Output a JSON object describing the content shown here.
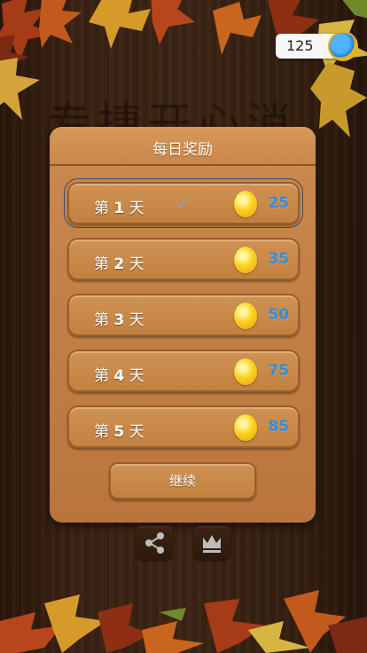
{
  "coins": {
    "value": "125"
  },
  "background_title": "专捷开心消",
  "dialog": {
    "title": "每日奖励",
    "rows": [
      {
        "prefix": "第",
        "num": "1",
        "suffix": "天",
        "amount": "25",
        "claimed": true
      },
      {
        "prefix": "第",
        "num": "2",
        "suffix": "天",
        "amount": "35",
        "claimed": false
      },
      {
        "prefix": "第",
        "num": "3",
        "suffix": "天",
        "amount": "50",
        "claimed": false
      },
      {
        "prefix": "第",
        "num": "4",
        "suffix": "天",
        "amount": "75",
        "claimed": false
      },
      {
        "prefix": "第",
        "num": "5",
        "suffix": "天",
        "amount": "85",
        "claimed": false
      }
    ],
    "continue_label": "继续"
  },
  "bottom_icons": [
    "share-icon",
    "crown-icon"
  ],
  "colors": {
    "amount": "#2f8ee0",
    "panel": "#c27f45",
    "check": "#8fa0b4"
  }
}
